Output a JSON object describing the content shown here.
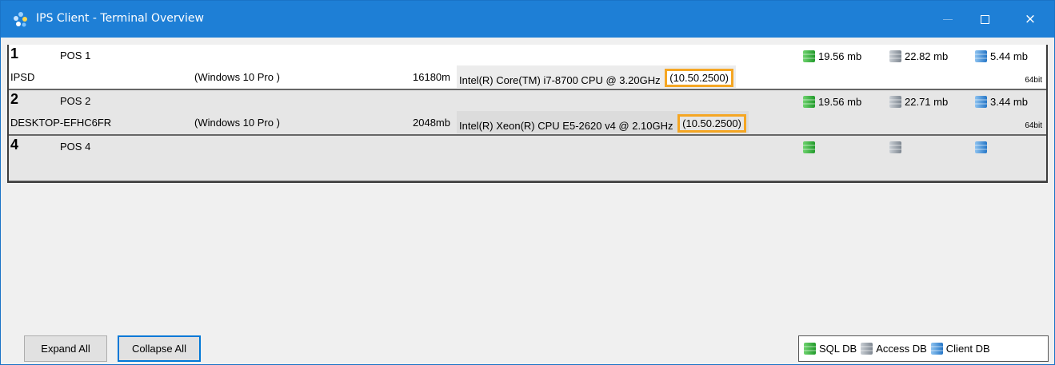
{
  "window": {
    "title": "IPS Client - Terminal Overview",
    "app_icon": "ips-logo-icon",
    "controls": {
      "minimize": "minimize-icon",
      "maximize": "maximize-icon",
      "close": "×"
    }
  },
  "terminals": [
    {
      "number": "1",
      "name": "POS 1",
      "host": "IPSD",
      "os": "(Windows 10 Pro )",
      "memory": "16180m",
      "cpu": "Intel(R) Core(TM) i7-8700 CPU @ 3.20GHz",
      "version": "(10.50.2500)",
      "arch": "64bit",
      "sql_db": "19.56 mb",
      "access_db": "22.82 mb",
      "client_db": "5.44 mb"
    },
    {
      "number": "2",
      "name": "POS 2",
      "host": "DESKTOP-EFHC6FR",
      "os": "(Windows 10 Pro )",
      "memory": "2048mb",
      "cpu": "Intel(R) Xeon(R) CPU E5-2620 v4 @ 2.10GHz",
      "version": "(10.50.2500)",
      "arch": "64bit",
      "sql_db": "19.56 mb",
      "access_db": "22.71 mb",
      "client_db": "3.44 mb"
    },
    {
      "number": "4",
      "name": "POS 4",
      "host": "",
      "os": "",
      "memory": "",
      "cpu": "",
      "version": "",
      "arch": "",
      "sql_db": "",
      "access_db": "",
      "client_db": ""
    }
  ],
  "buttons": {
    "expand_all": "Expand All",
    "collapse_all": "Collapse All"
  },
  "legend": {
    "sql": "SQL DB",
    "access": "Access DB",
    "client": "Client DB"
  },
  "colors": {
    "titlebar": "#1e7fd6",
    "highlight": "#f5a623",
    "sql_db": "#3cb043",
    "access_db": "#9aa3ad",
    "client_db": "#3a8fd9"
  }
}
